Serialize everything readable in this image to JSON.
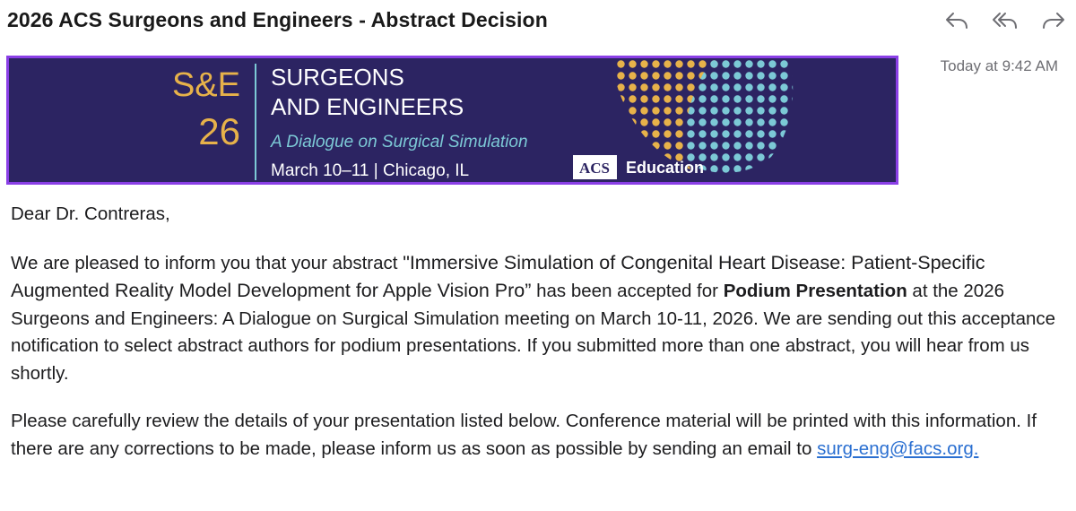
{
  "email": {
    "subject": "2026 ACS Surgeons and Engineers - Abstract Decision",
    "timestamp": "Today at 9:42 AM"
  },
  "toolbar": {
    "reply_icon": "reply-icon",
    "reply_all_icon": "reply-all-icon",
    "forward_icon": "forward-icon"
  },
  "banner": {
    "logo_line1": "S&E",
    "logo_line2": "26",
    "title_line1": "SURGEONS",
    "title_line2": "AND ENGINEERS",
    "tagline": "A Dialogue on Surgical Simulation",
    "date_location": "March 10–11 | Chicago, IL",
    "acs_mark": "ACS",
    "education": "Education",
    "colors": {
      "background": "#2c2462",
      "border": "#8a3fe6",
      "gold": "#e7b24a",
      "teal": "#7cc9d6"
    }
  },
  "body": {
    "greeting": "Dear Dr. Contreras,",
    "para1_start": "We are pleased to inform you that your abstract ",
    "abstract_title": "\"Immersive Simulation of Congenital Heart Disease: Patient-Specific Augmented Reality Model Development for Apple Vision Pro”",
    "para1_mid": " has been accepted for ",
    "presentation_type": "Podium Presentation",
    "para1_end": " at the 2026 Surgeons and Engineers: A Dialogue on Surgical Simulation meeting on March 10-11, 2026. We are sending out this acceptance notification to select abstract authors for podium presentations. If you submitted more than one abstract, you will hear from us shortly.",
    "para2_start": "Please carefully review the details of your presentation listed below. Conference material will be printed with this information. If there are any corrections to be made, please inform us as soon as possible by sending an email to ",
    "email_link": "surg-eng@facs.org."
  }
}
